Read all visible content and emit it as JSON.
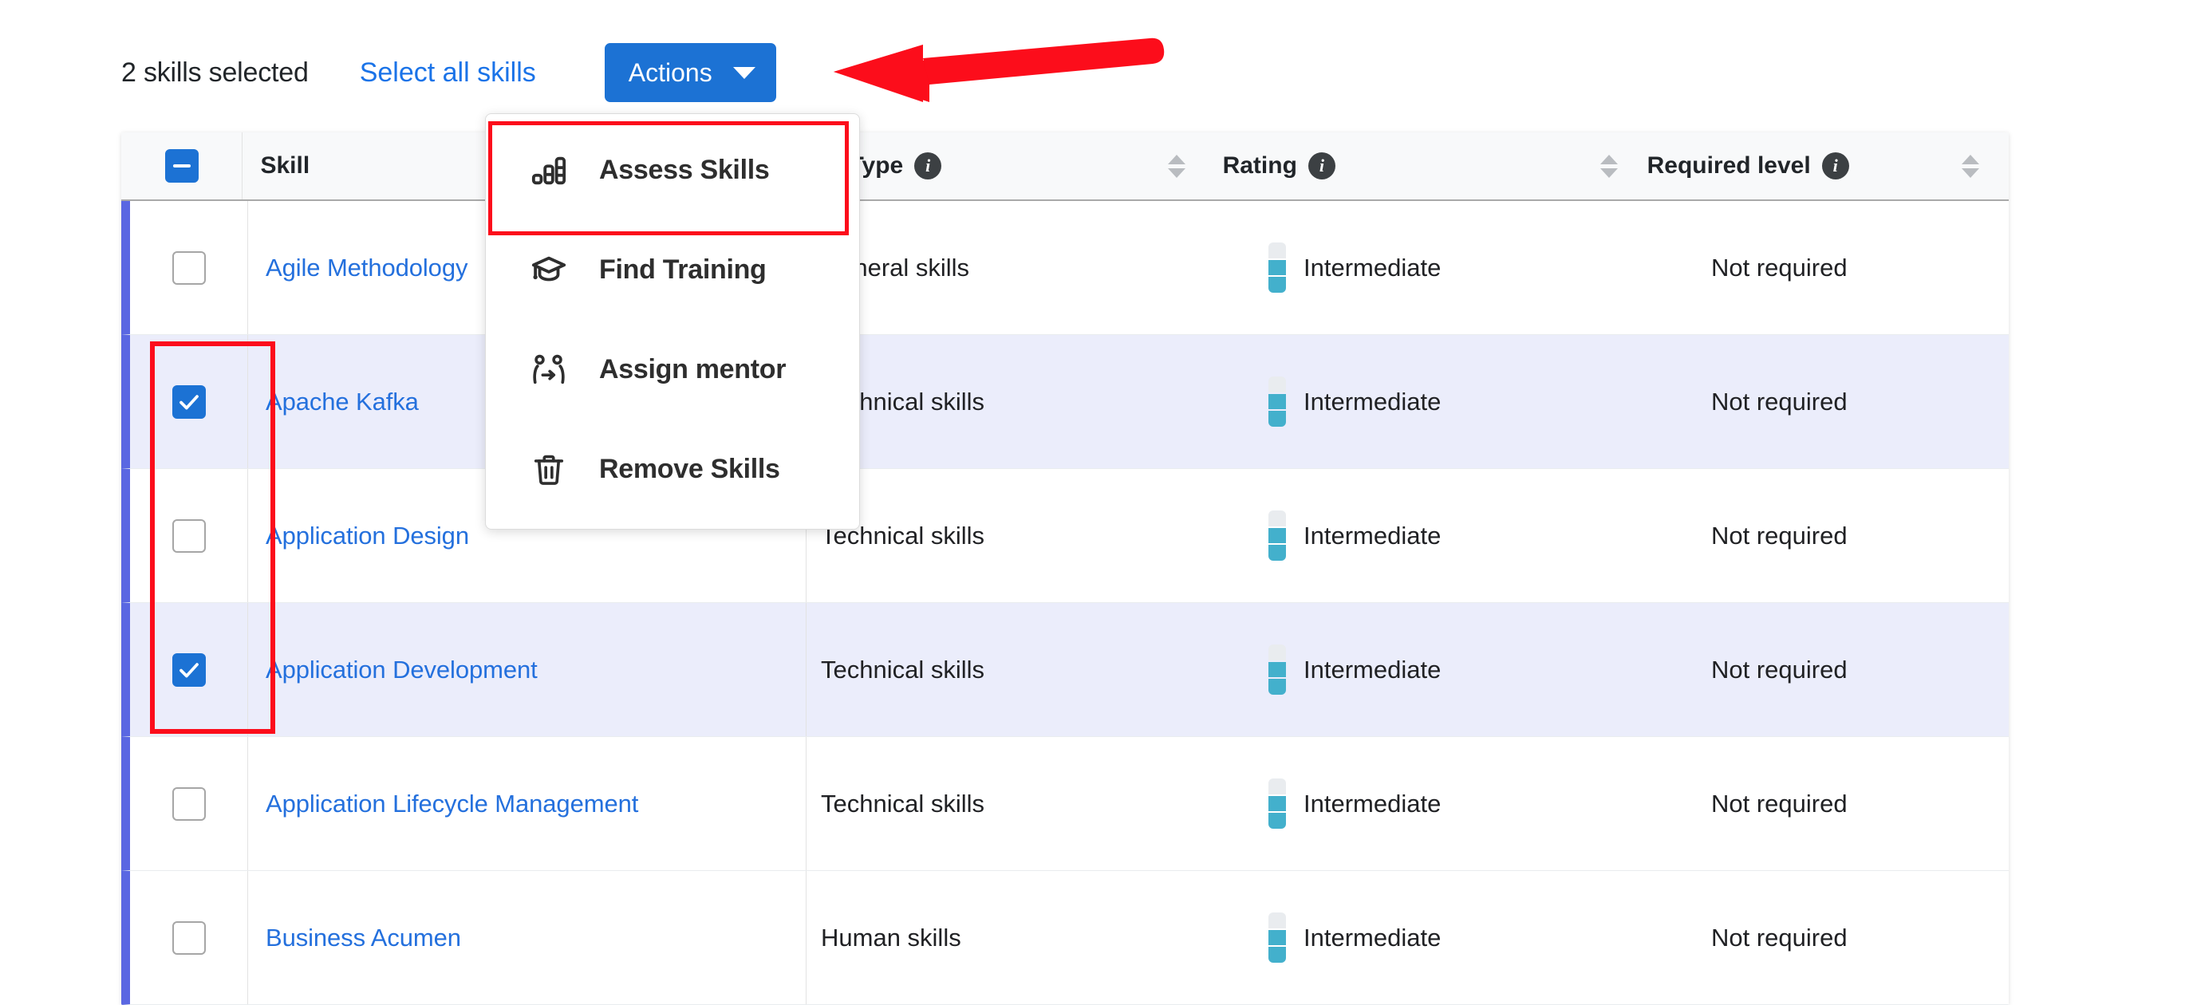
{
  "toolbar": {
    "selected_count_label": "2 skills selected",
    "select_all_label": "Select all skills",
    "actions_label": "Actions",
    "actions_caret_icon": "chevron-down-icon"
  },
  "annotations": {
    "arrow_color": "#fc0d1b",
    "highlight_color": "#fc0d1b"
  },
  "actions_menu": {
    "items": [
      {
        "label": "Assess Skills",
        "icon": "bar-chart-icon",
        "highlighted": true
      },
      {
        "label": "Find Training",
        "icon": "graduation-cap-icon",
        "highlighted": false
      },
      {
        "label": "Assign mentor",
        "icon": "assign-person-icon",
        "highlighted": false
      },
      {
        "label": "Remove Skills",
        "icon": "trash-icon",
        "highlighted": false
      }
    ]
  },
  "table": {
    "header": {
      "select_all_checkbox_state": "indeterminate",
      "skill": "Skill",
      "skill_type": "Skill Type",
      "skill_type_info_icon": "info-icon",
      "rating": "Rating",
      "rating_info_icon": "info-icon",
      "required_level": "Required level",
      "required_level_info_icon": "info-icon",
      "sort_icon": "sort-updown-icon"
    },
    "rows": [
      {
        "checked": false,
        "skill": "Agile Methodology",
        "skill_type": "General skills",
        "rating": "Intermediate",
        "rating_level": 2,
        "rating_max": 3,
        "required_level": "Not required"
      },
      {
        "checked": true,
        "skill": "Apache Kafka",
        "skill_type": "Technical skills",
        "rating": "Intermediate",
        "rating_level": 2,
        "rating_max": 3,
        "required_level": "Not required"
      },
      {
        "checked": false,
        "skill": "Application Design",
        "skill_type": "Technical skills",
        "rating": "Intermediate",
        "rating_level": 2,
        "rating_max": 3,
        "required_level": "Not required"
      },
      {
        "checked": true,
        "skill": "Application Development",
        "skill_type": "Technical skills",
        "rating": "Intermediate",
        "rating_level": 2,
        "rating_max": 3,
        "required_level": "Not required"
      },
      {
        "checked": false,
        "skill": "Application Lifecycle Management",
        "skill_type": "Technical skills",
        "rating": "Intermediate",
        "rating_level": 2,
        "rating_max": 3,
        "required_level": "Not required"
      },
      {
        "checked": false,
        "skill": "Business Acumen",
        "skill_type": "Human skills",
        "rating": "Intermediate",
        "rating_level": 2,
        "rating_max": 3,
        "required_level": "Not required"
      }
    ]
  },
  "colors": {
    "primary_blue": "#1c72d4",
    "link_blue": "#2470dd",
    "row_accent": "#5a67e2",
    "selected_row_bg": "#ebedfb",
    "rating_teal": "#43b0cc",
    "annotation_red": "#fc0d1b"
  }
}
